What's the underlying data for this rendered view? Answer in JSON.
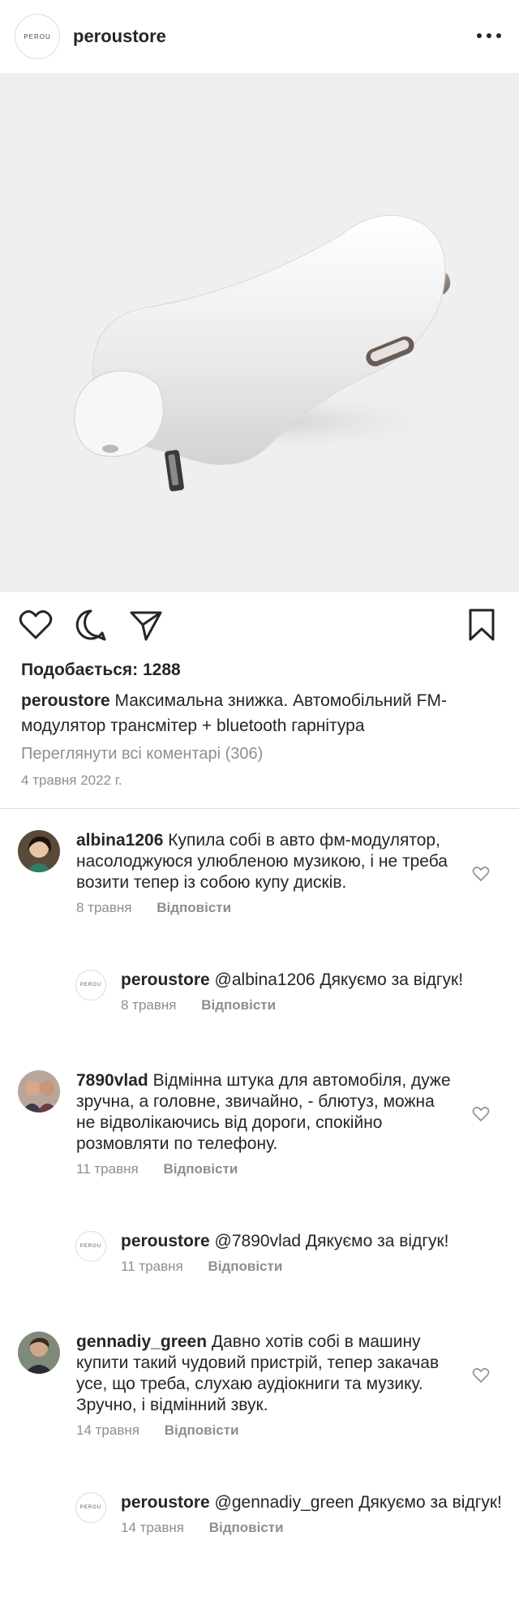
{
  "header": {
    "logo_text": "PEROU",
    "username": "peroustore"
  },
  "post": {
    "likes": "Подобається: 1288",
    "caption_user": "peroustore",
    "caption_text": "Максимальна знижка. Автомобільний FM-модулятор трансмітер + bluetooth гарнітура",
    "view_all": "Переглянути всі коментарі (306)",
    "date": "4 травня 2022 г."
  },
  "comments": [
    {
      "user": "albina1206",
      "text": "Купила собі в авто фм-модулятор, насолоджуюся улюбленою музикою, і не треба возити тепер із собою купу дисків.",
      "date": "8 травня",
      "reply_label": "Відповісти"
    },
    {
      "user": "peroustore",
      "text": "@albina1206 Дякуємо за відгук!",
      "date": "8 травня",
      "reply_label": "Відповісти",
      "avatar_text": "PEROU"
    },
    {
      "user": "7890vlad",
      "text": "Відмінна штука для автомобіля, дуже зручна, а головне, звичайно, - блютуз, можна не відволікаючись від дороги, спокійно розмовляти по телефону.",
      "date": "11 травня",
      "reply_label": "Відповісти"
    },
    {
      "user": "peroustore",
      "text": "@7890vlad Дякуємо за відгук!",
      "date": "11 травня",
      "reply_label": "Відповісти",
      "avatar_text": "PEROU"
    },
    {
      "user": "gennadiy_green",
      "text": "Давно хотів собі в машину купити такий чудовий пристрій, тепер закачав усе, що треба, слухаю аудіокниги та музику. Зручно, і відмінний звук.",
      "date": "14 травня",
      "reply_label": "Відповісти"
    },
    {
      "user": "peroustore",
      "text": "@gennadiy_green Дякуємо за відгук!",
      "date": "14 травня",
      "reply_label": "Відповісти",
      "avatar_text": "PEROU"
    }
  ],
  "icons": {
    "like": "heart-icon",
    "comment": "comment-icon",
    "share": "send-icon",
    "save": "bookmark-icon",
    "more": "more-options-icon"
  },
  "colors": {
    "text": "#262626",
    "secondary": "#8e8e8e",
    "border": "#dbdbdb",
    "photo_bg": "#efefef"
  }
}
